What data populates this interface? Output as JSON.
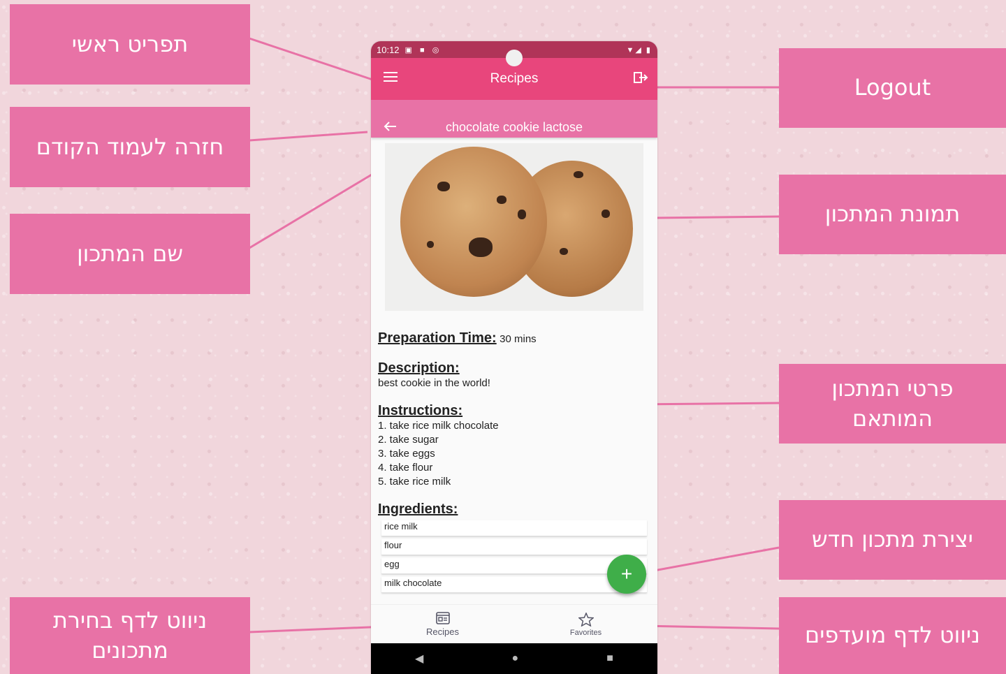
{
  "callouts": {
    "main_menu": "תפריט ראשי",
    "back": "חזרה לעמוד הקודם",
    "recipe_name": "שם המתכון",
    "nav_recipes": "ניווט לדף בחירת מתכונים",
    "logout": "Logout",
    "recipe_image": "תמונת המתכון",
    "recipe_details": "פרטי המתכון המותאם",
    "new_recipe": "יצירת מתכון חדש",
    "nav_favorites": "ניווט לדף מועדפים"
  },
  "status": {
    "time": "10:12"
  },
  "appbar": {
    "title": "Recipes"
  },
  "recipe": {
    "name": "chocolate cookie lactose",
    "prep_label": "Preparation Time:",
    "prep_value": "30 mins",
    "desc_label": "Description:",
    "desc_value": "best cookie in the world!",
    "instr_label": "Instructions:",
    "instructions": [
      "1. take rice milk chocolate",
      "2. take sugar",
      "3. take eggs",
      "4. take flour",
      "5. take rice milk"
    ],
    "ingr_label": "Ingredients:",
    "ingredients": [
      "rice milk",
      "flour",
      "egg",
      "milk chocolate"
    ]
  },
  "fab": {
    "label": "+"
  },
  "bottomnav": {
    "recipes": "Recipes",
    "favorites": "Favorites"
  },
  "colors": {
    "appbar": "#e8467c",
    "subbar": "#e872a6",
    "status": "#b03458",
    "fab": "#3fae49",
    "callout": "#e872a6"
  }
}
